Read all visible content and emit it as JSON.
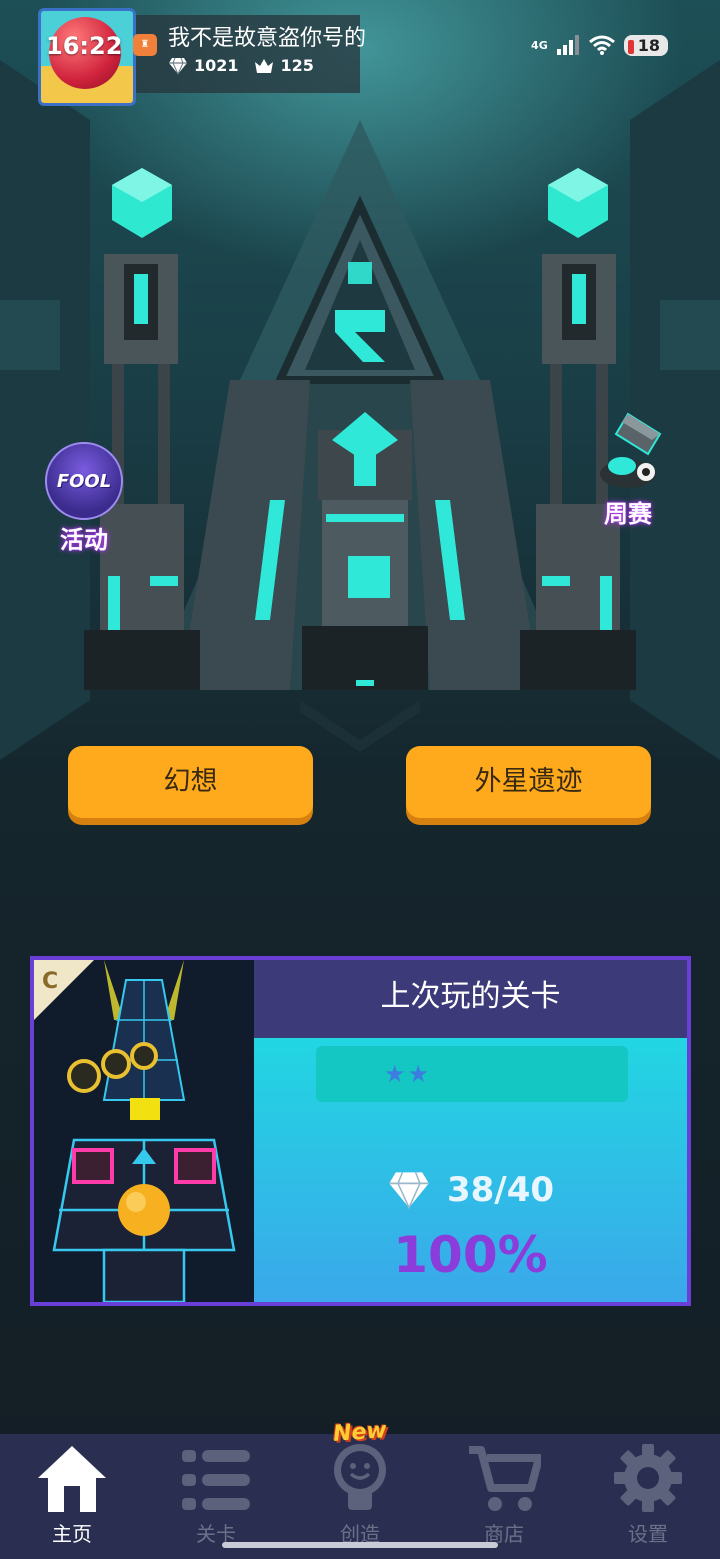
{
  "status_bar": {
    "time": "16:22",
    "network": "4G",
    "battery": "18"
  },
  "profile": {
    "name": "我不是故意盗你号的",
    "gems": "1021",
    "crowns": "125"
  },
  "side_buttons": {
    "event_badge": "FOOL",
    "event_label": "活动",
    "weekly_label": "周赛"
  },
  "modes": {
    "left": "幻想",
    "right": "外星遗迹"
  },
  "last_played": {
    "title": "上次玩的关卡",
    "grade": "C",
    "stars": "★★",
    "gems": "38/40",
    "percent": "100%"
  },
  "nav": {
    "new_badge": "New",
    "items": [
      {
        "label": "主页",
        "icon": "home-icon"
      },
      {
        "label": "关卡",
        "icon": "list-icon"
      },
      {
        "label": "创造",
        "icon": "lightbulb-icon"
      },
      {
        "label": "商店",
        "icon": "cart-icon"
      },
      {
        "label": "设置",
        "icon": "gear-icon"
      }
    ]
  },
  "colors": {
    "mode_button": "#ffaa1c",
    "card_border": "#6a3fd8",
    "nav_bg": "#2a2f52",
    "accent_teal": "#2fe8d8"
  }
}
